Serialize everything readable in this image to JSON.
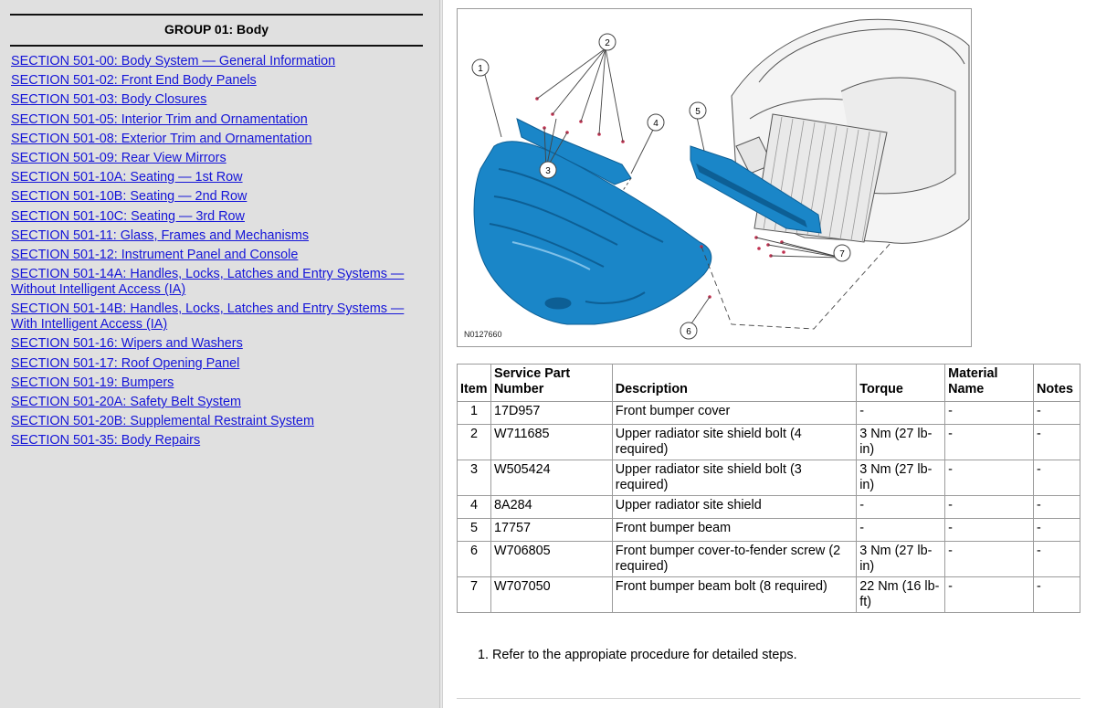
{
  "nav": {
    "group_title": "GROUP 01: Body",
    "sections": [
      {
        "label": "SECTION 501-00: Body System — General Information"
      },
      {
        "label": "SECTION 501-02: Front End Body Panels"
      },
      {
        "label": "SECTION 501-03: Body Closures"
      },
      {
        "label": "SECTION 501-05: Interior Trim and Ornamentation"
      },
      {
        "label": "SECTION 501-08: Exterior Trim and Ornamentation"
      },
      {
        "label": "SECTION 501-09: Rear View Mirrors"
      },
      {
        "label": "SECTION 501-10A: Seating — 1st Row"
      },
      {
        "label": "SECTION 501-10B: Seating — 2nd Row"
      },
      {
        "label": "SECTION 501-10C: Seating — 3rd Row"
      },
      {
        "label": "SECTION 501-11: Glass, Frames and Mechanisms"
      },
      {
        "label": "SECTION 501-12: Instrument Panel and Console"
      },
      {
        "label": "SECTION 501-14A: Handles, Locks, Latches and Entry Systems — Without Intelligent Access (IA)"
      },
      {
        "label": "SECTION 501-14B: Handles, Locks, Latches and Entry Systems — With Intelligent Access (IA)"
      },
      {
        "label": "SECTION 501-16: Wipers and Washers"
      },
      {
        "label": "SECTION 501-17: Roof Opening Panel"
      },
      {
        "label": "SECTION 501-19: Bumpers"
      },
      {
        "label": "SECTION 501-20A: Safety Belt System"
      },
      {
        "label": "SECTION 501-20B: Supplemental Restraint System"
      },
      {
        "label": "SECTION 501-35: Body Repairs"
      }
    ]
  },
  "figure": {
    "id": "N0127660",
    "callouts": [
      "1",
      "2",
      "3",
      "4",
      "5",
      "6",
      "7"
    ],
    "colors": {
      "bumper": "#1a86c8",
      "bumper_dark": "#0d5f95",
      "line": "#444444"
    }
  },
  "table": {
    "headers": {
      "item": "Item",
      "service_part_number": "Service Part Number",
      "description": "Description",
      "torque": "Torque",
      "material_name": "Material Name",
      "notes": "Notes"
    },
    "rows": [
      {
        "item": "1",
        "part": "17D957",
        "description": "Front bumper cover",
        "torque": "-",
        "material": "-",
        "notes": "-"
      },
      {
        "item": "2",
        "part": "W711685",
        "description": "Upper radiator site shield bolt (4 required)",
        "torque": "3 Nm (27 lb-in)",
        "material": "-",
        "notes": "-"
      },
      {
        "item": "3",
        "part": "W505424",
        "description": "Upper radiator site shield bolt (3 required)",
        "torque": "3 Nm (27 lb-in)",
        "material": "-",
        "notes": "-"
      },
      {
        "item": "4",
        "part": "8A284",
        "description": "Upper radiator site shield",
        "torque": "-",
        "material": "-",
        "notes": "-"
      },
      {
        "item": "5",
        "part": "17757",
        "description": "Front bumper beam",
        "torque": "-",
        "material": "-",
        "notes": "-"
      },
      {
        "item": "6",
        "part": "W706805",
        "description": "Front bumper cover-to-fender screw (2 required)",
        "torque": "3 Nm (27 lb-in)",
        "material": "-",
        "notes": "-"
      },
      {
        "item": "7",
        "part": "W707050",
        "description": "Front bumper beam bolt (8 required)",
        "torque": "22 Nm (16 lb-ft)",
        "material": "-",
        "notes": "-"
      }
    ]
  },
  "note": "1. Refer to the appropiate procedure for detailed steps."
}
